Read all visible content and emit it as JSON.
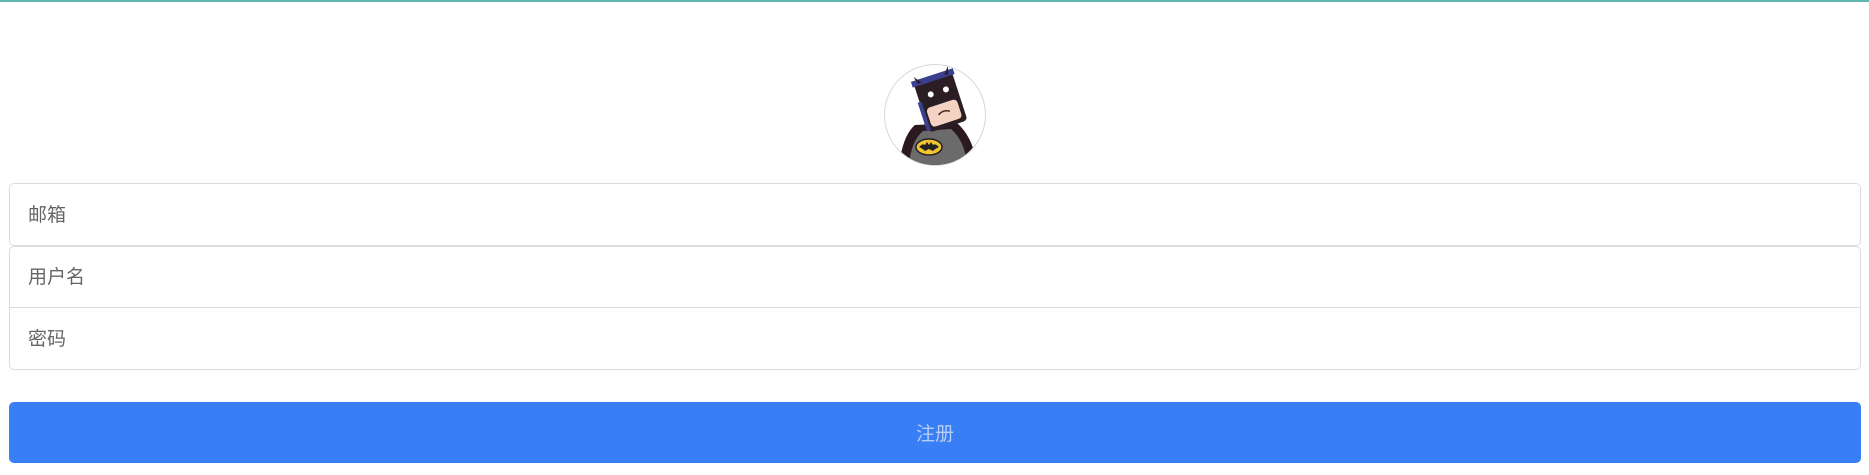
{
  "form": {
    "email_placeholder": "邮箱",
    "username_placeholder": "用户名",
    "password_placeholder": "密码",
    "submit_label": "注册"
  },
  "colors": {
    "accent": "#387ef5",
    "top_line": "#5fb7b3",
    "border": "#dcdcdc"
  },
  "icons": {
    "avatar": "batman-avatar"
  }
}
